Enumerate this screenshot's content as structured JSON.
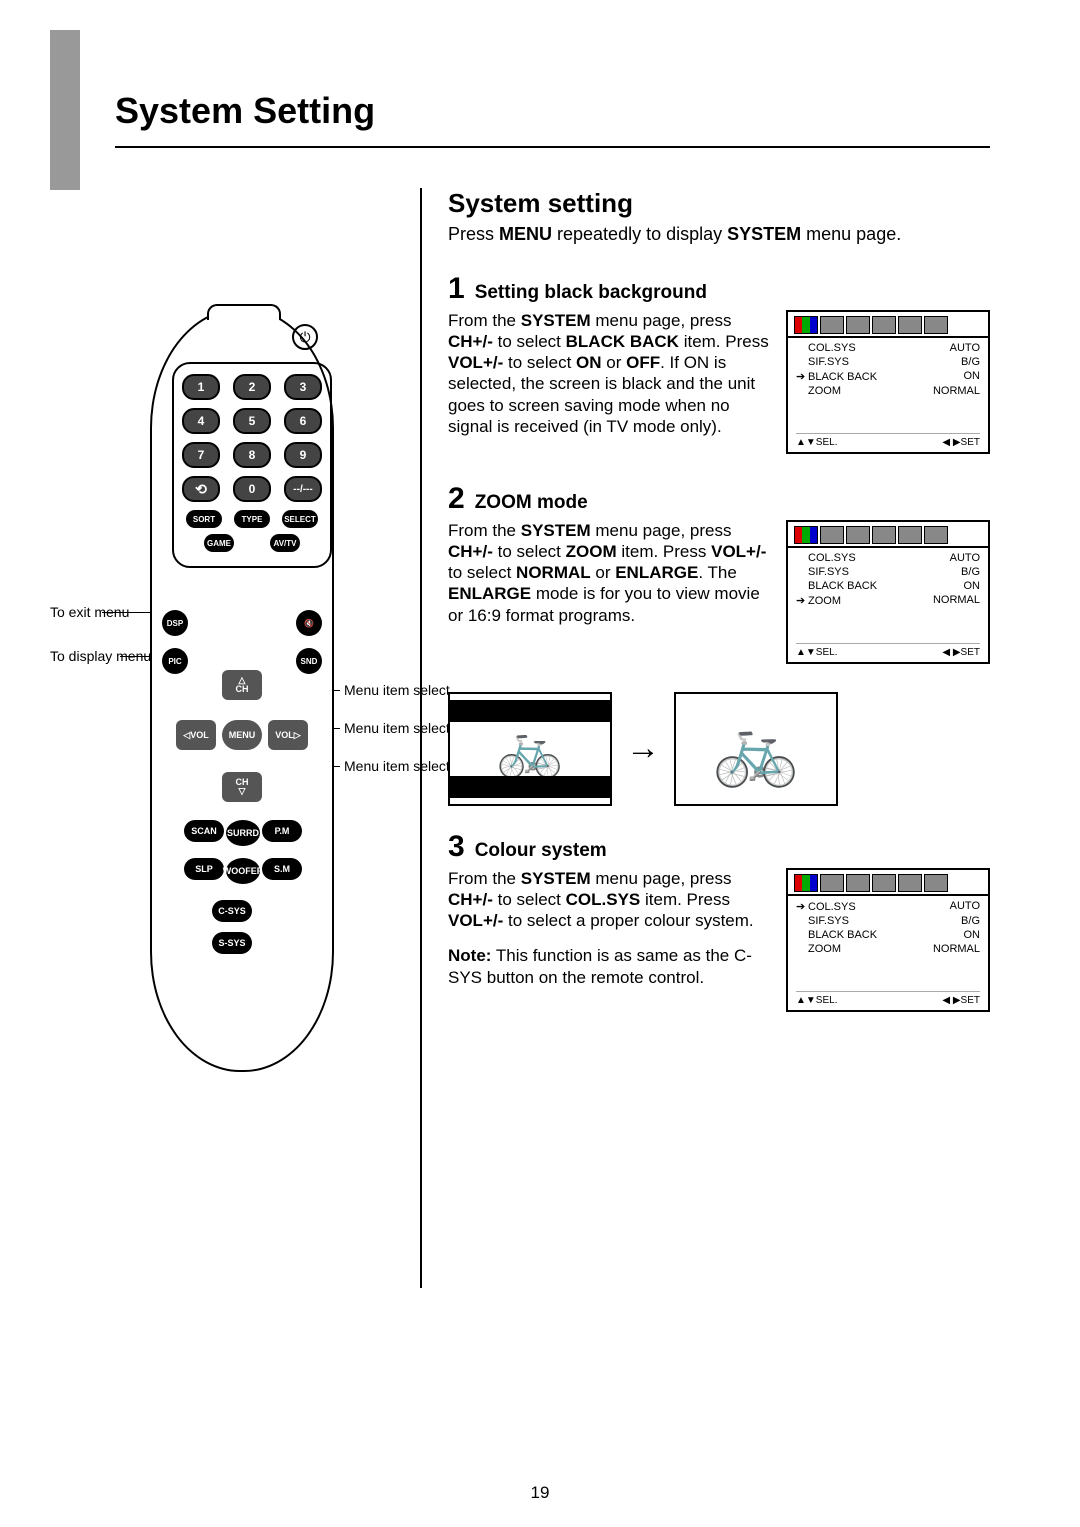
{
  "page_number": "19",
  "main_title": "System Setting",
  "section": {
    "heading": "System setting",
    "intro_a": "Press ",
    "intro_b": "MENU",
    "intro_c": " repeatedly to display ",
    "intro_d": "SYSTEM",
    "intro_e": " menu page."
  },
  "steps": [
    {
      "num": "1",
      "title": "Setting black background",
      "text_parts": [
        "From the ",
        "SYSTEM",
        " menu page, press ",
        "CH+/-",
        " to select ",
        "BLACK BACK",
        " item. Press ",
        "VOL+/-",
        " to select ",
        "ON",
        " or ",
        "OFF",
        ". If ON is selected, the screen is black and the unit goes to screen saving mode when no signal is received (in TV mode only)."
      ],
      "osd_selected": 2,
      "note": null
    },
    {
      "num": "2",
      "title": "ZOOM mode",
      "text_parts": [
        "From the ",
        "SYSTEM",
        " menu page, press ",
        "CH+/-",
        " to select ",
        "ZOOM",
        " item. Press ",
        "VOL+/-",
        " to select ",
        "NORMAL",
        " or ",
        "ENLARGE",
        ". The ",
        "ENLARGE",
        " mode is for you to view movie or 16:9 format programs."
      ],
      "osd_selected": 3,
      "note": null
    },
    {
      "num": "3",
      "title": "Colour system",
      "text_parts": [
        "From the ",
        "SYSTEM",
        " menu page, press ",
        "CH+/-",
        " to select ",
        "COL.SYS",
        " item. Press ",
        "VOL+/-",
        " to select a proper colour system."
      ],
      "osd_selected": 0,
      "note_parts": [
        "Note:",
        " This function is as same as the C-SYS button on the remote control."
      ]
    }
  ],
  "osd": {
    "items": [
      {
        "label": "COL.SYS",
        "value": "AUTO"
      },
      {
        "label": "SIF.SYS",
        "value": "B/G"
      },
      {
        "label": "BLACK BACK",
        "value": "ON"
      },
      {
        "label": "ZOOM",
        "value": "NORMAL"
      }
    ],
    "footer_left": "▲▼SEL.",
    "footer_right": "◀ ▶SET"
  },
  "remote": {
    "labels": {
      "exit": "To exit menu",
      "display": "To display menu page",
      "menu_item": "Menu item select"
    },
    "numpad": [
      "1",
      "2",
      "3",
      "4",
      "5",
      "6",
      "7",
      "8",
      "9"
    ],
    "zero": "0",
    "dash": "--/---",
    "small_row1": [
      "SORT",
      "TYPE",
      "SELECT"
    ],
    "small_row2": [
      "GAME",
      "AV/TV"
    ],
    "circles": {
      "dsp": "DSP",
      "pic": "PIC",
      "snd": "SND",
      "mute": "🔇"
    },
    "dpad": {
      "up": "△\nCH",
      "down": "CH\n▽",
      "left": "◁VOL",
      "right": "VOL▷",
      "center": "MENU"
    },
    "row_a": [
      "SCAN",
      "SURRD",
      "P.M"
    ],
    "row_b": [
      "SLP",
      "WOOFER",
      "S.M"
    ],
    "bottom": [
      "C-SYS",
      "S-SYS"
    ]
  }
}
